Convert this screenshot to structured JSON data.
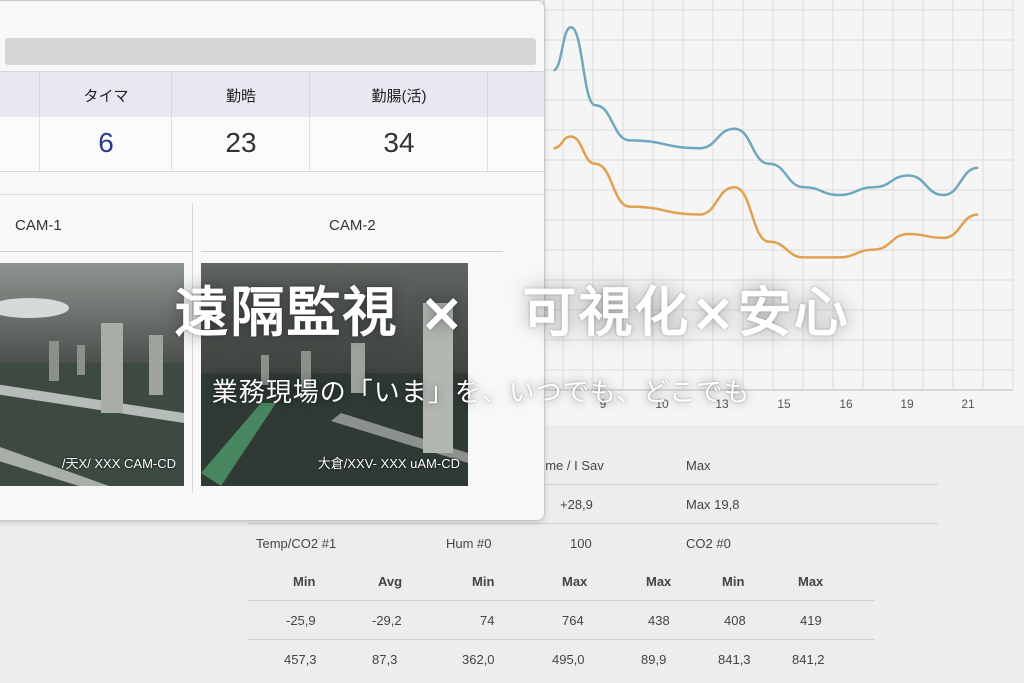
{
  "hero": {
    "title": "遠隔監視 ×　可視化×安心",
    "subtitle": "業務現場の「いま」を、いつでも、どこでも"
  },
  "dashboard": {
    "metrics": [
      {
        "label": "タイマ",
        "value": "6",
        "accent": true
      },
      {
        "label": "勤晧",
        "value": "23",
        "accent": false
      },
      {
        "label": "勤腸(活)",
        "value": "34",
        "accent": false
      }
    ],
    "cameras": [
      {
        "title": "CAM-1",
        "caption": "/天X/ XXX CAM-CD"
      },
      {
        "title": "CAM-2",
        "caption": "大倉/XXV- XXX uAM-CD"
      }
    ]
  },
  "chart_data": {
    "type": "line",
    "x_tick_labels": [
      "9",
      "10",
      "13",
      "15",
      "16",
      "19",
      "21"
    ],
    "grid": true,
    "series": [
      {
        "color": "#6fa8bd",
        "points": [
          [
            7.8,
            0.82
          ],
          [
            8.3,
            0.93
          ],
          [
            9,
            0.73
          ],
          [
            10,
            0.64
          ],
          [
            12,
            0.62
          ],
          [
            13,
            0.67
          ],
          [
            14,
            0.58
          ],
          [
            15,
            0.52
          ],
          [
            16,
            0.5
          ],
          [
            17,
            0.52
          ],
          [
            18,
            0.55
          ],
          [
            19,
            0.5
          ],
          [
            20,
            0.57
          ]
        ]
      },
      {
        "color": "#e0a150",
        "points": [
          [
            7.8,
            0.62
          ],
          [
            8.3,
            0.65
          ],
          [
            9,
            0.58
          ],
          [
            10,
            0.47
          ],
          [
            12,
            0.45
          ],
          [
            13,
            0.52
          ],
          [
            14,
            0.38
          ],
          [
            15,
            0.34
          ],
          [
            16,
            0.34
          ],
          [
            17,
            0.36
          ],
          [
            18,
            0.4
          ],
          [
            19,
            0.39
          ],
          [
            20,
            0.45
          ]
        ]
      }
    ]
  },
  "stats": {
    "row1": {
      "a": "eme / I Sav",
      "b": "Max"
    },
    "row2": {
      "a": "+28,9",
      "b": "Max 19,8"
    },
    "row3": {
      "a": "Temp/CO2 #1",
      "b": "Hum #0",
      "c": "100",
      "d": "CO2 #0"
    },
    "headers": [
      "Min",
      "Avg",
      "Min",
      "Max",
      "Max",
      "Min",
      "Max"
    ],
    "rows": [
      [
        "-25,9",
        "-29,2",
        "74",
        "764",
        "438",
        "408",
        "419"
      ],
      [
        "457,3",
        "87,3",
        "362,0",
        "495,0",
        "89,9",
        "841,3",
        "841,2"
      ]
    ]
  }
}
